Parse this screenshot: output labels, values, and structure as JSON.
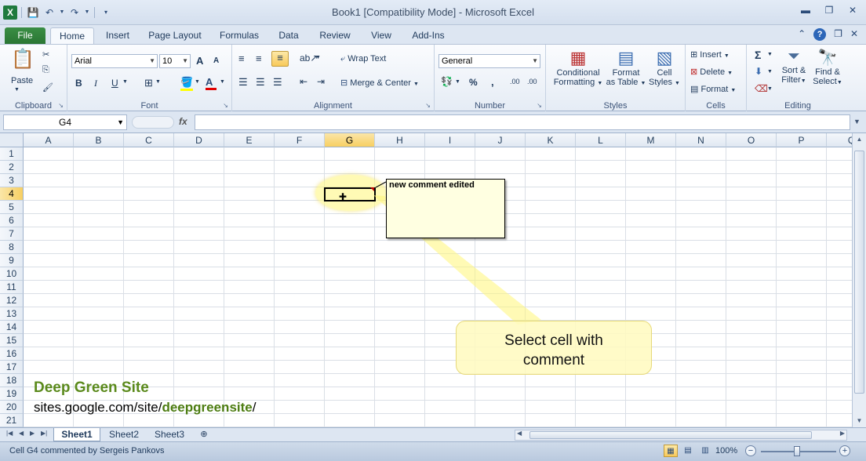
{
  "window": {
    "title": "Book1  [Compatibility Mode]  -  Microsoft Excel",
    "app_icon": "X",
    "controls": [
      "minimize-icon",
      "restore-icon",
      "close-icon"
    ]
  },
  "ribbon_tabs": [
    "File",
    "Home",
    "Insert",
    "Page Layout",
    "Formulas",
    "Data",
    "Review",
    "View",
    "Add-Ins"
  ],
  "active_tab": "Home",
  "ribbon": {
    "clipboard": {
      "label": "Clipboard",
      "paste": "Paste"
    },
    "font": {
      "label": "Font",
      "font_name": "Arial",
      "font_size": "10",
      "bold": "B",
      "italic": "I",
      "underline": "U",
      "grow": "A",
      "shrink": "A",
      "font_color": "A"
    },
    "alignment": {
      "label": "Alignment",
      "wrap_text": "Wrap Text",
      "merge_center": "Merge & Center"
    },
    "number": {
      "label": "Number",
      "format": "General",
      "percent": "%",
      "comma": ",",
      "inc_dec": ".00",
      "dec_dec": ".00"
    },
    "styles": {
      "label": "Styles",
      "conditional": [
        "Conditional",
        "Formatting"
      ],
      "format_table": [
        "Format",
        "as Table"
      ],
      "cell_styles": [
        "Cell",
        "Styles"
      ]
    },
    "cells": {
      "label": "Cells",
      "insert": "Insert",
      "delete": "Delete",
      "format": "Format"
    },
    "editing": {
      "label": "Editing",
      "sort_filter": [
        "Sort &",
        "Filter"
      ],
      "find_select": [
        "Find &",
        "Select"
      ],
      "sum": "Σ"
    }
  },
  "formula_bar": {
    "name_box": "G4",
    "fx": "fx",
    "content": ""
  },
  "columns": [
    "A",
    "B",
    "C",
    "D",
    "E",
    "F",
    "G",
    "H",
    "I",
    "J",
    "K",
    "L",
    "M",
    "N",
    "O",
    "P",
    "Q"
  ],
  "rows": [
    "1",
    "2",
    "3",
    "4",
    "5",
    "6",
    "7",
    "8",
    "9",
    "10",
    "11",
    "12",
    "13",
    "14",
    "15",
    "16",
    "17",
    "18",
    "19",
    "20",
    "21"
  ],
  "selected_cell": {
    "column": "G",
    "row": "4"
  },
  "comment": {
    "text": "new comment edited"
  },
  "callout": {
    "lines": [
      "Select cell with",
      "comment"
    ]
  },
  "brand": {
    "title": "Deep Green Site",
    "url_prefix": "sites.google.com/site/",
    "url_bold": "deepgreensite",
    "url_suffix": "/"
  },
  "sheet_tabs": [
    "Sheet1",
    "Sheet2",
    "Sheet3"
  ],
  "active_sheet": "Sheet1",
  "status": {
    "text": "Cell G4 commented by Sergeis Pankovs",
    "zoom": "100%"
  }
}
